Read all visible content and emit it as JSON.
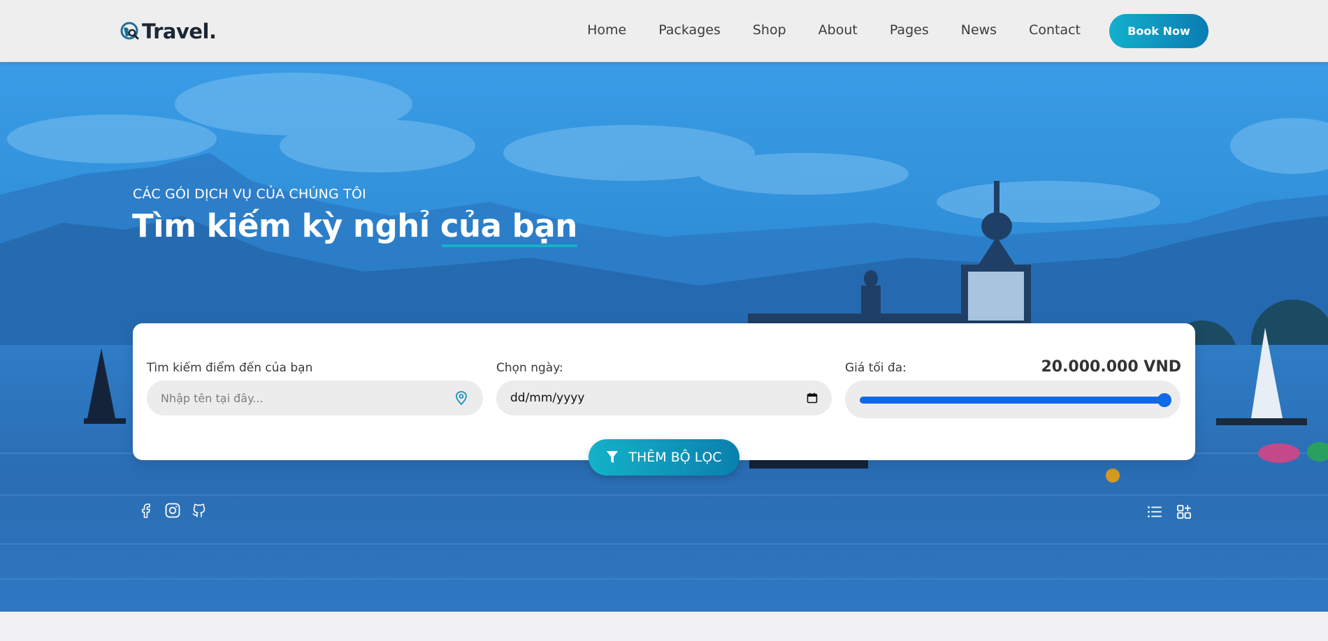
{
  "header": {
    "logo_text": "Travel.",
    "nav": [
      "Home",
      "Packages",
      "Shop",
      "About",
      "Pages",
      "News",
      "Contact"
    ],
    "book_label": "Book Now"
  },
  "hero": {
    "subtitle": "CÁC GÓI DỊCH VỤ CỦA CHÚNG TÔI",
    "title_part1": "Tìm kiếm kỳ nghỉ ",
    "title_highlight": "của bạn"
  },
  "search": {
    "destination_label": "Tìm kiếm điểm đến của bạn",
    "destination_placeholder": "Nhập tên tại đây...",
    "date_label": "Chọn ngày:",
    "date_value": "dd/mm/yyyy",
    "price_label": "Giá tối đa:",
    "price_value": "20.000.000 VND",
    "price_fraction": 1.0,
    "filter_label": "THÊM BỘ LỌC"
  },
  "social": [
    "facebook-icon",
    "instagram-icon",
    "github-icon"
  ],
  "view_toggle": [
    "list-view-icon",
    "grid-view-icon"
  ],
  "colors": {
    "accent": "#13b0cc",
    "accent_dark": "#0a7cb3",
    "slider": "#1269e6"
  }
}
